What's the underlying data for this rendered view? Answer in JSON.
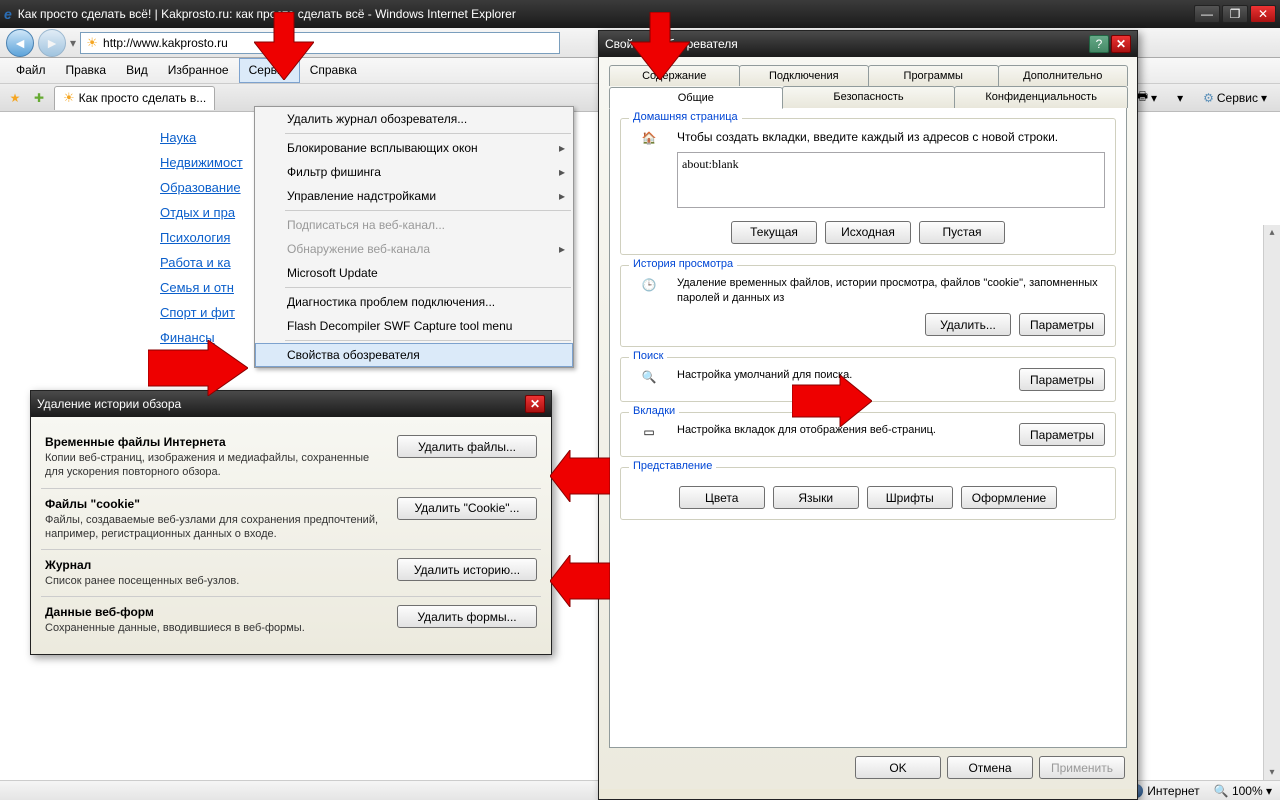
{
  "window": {
    "title": "Как просто сделать всё! | Kakprosto.ru: как просто сделать всё - Windows Internet Explorer"
  },
  "address": {
    "url": "http://www.kakprosto.ru"
  },
  "menubar": [
    "Файл",
    "Правка",
    "Вид",
    "Избранное",
    "Сервис",
    "Справка"
  ],
  "tab": {
    "label": "Как просто сделать в..."
  },
  "rightTools": {
    "service": "Сервис"
  },
  "sidebar": [
    "Наука",
    "Недвижимост",
    "Образование",
    "Отдых и пра",
    "Психология",
    "Работа и ка",
    "Семья и отн",
    "Спорт и фит",
    "Финансы"
  ],
  "dropdown": {
    "items": [
      {
        "label": "Удалить журнал обозревателя...",
        "type": "item"
      },
      {
        "type": "sep"
      },
      {
        "label": "Блокирование всплывающих окон",
        "type": "sub"
      },
      {
        "label": "Фильтр фишинга",
        "type": "sub"
      },
      {
        "label": "Управление надстройками",
        "type": "sub"
      },
      {
        "type": "sep"
      },
      {
        "label": "Подписаться на веб-канал...",
        "type": "item",
        "disabled": true
      },
      {
        "label": "Обнаружение веб-канала",
        "type": "sub",
        "disabled": true
      },
      {
        "label": "Microsoft Update",
        "type": "item"
      },
      {
        "type": "sep"
      },
      {
        "label": "Диагностика проблем подключения...",
        "type": "item"
      },
      {
        "label": "Flash Decompiler SWF Capture tool menu",
        "type": "item"
      },
      {
        "type": "sep"
      },
      {
        "label": "Свойства обозревателя",
        "type": "item",
        "hover": true
      }
    ]
  },
  "delDlg": {
    "title": "Удаление истории обзора",
    "sections": [
      {
        "h": "Временные файлы Интернета",
        "d": "Копии веб-страниц, изображения и медиафайлы, сохраненные для ускорения повторного обзора.",
        "btn": "Удалить файлы..."
      },
      {
        "h": "Файлы \"cookie\"",
        "d": "Файлы, создаваемые веб-узлами для сохранения предпочтений, например, регистрационных данных о входе.",
        "btn": "Удалить \"Cookie\"..."
      },
      {
        "h": "Журнал",
        "d": "Список ранее посещенных веб-узлов.",
        "btn": "Удалить историю..."
      },
      {
        "h": "Данные веб-форм",
        "d": "Сохраненные данные, вводившиеся в веб-формы.",
        "btn": "Удалить формы..."
      }
    ]
  },
  "optDlg": {
    "title": "Свойства обозревателя",
    "tabsRow1": [
      "Содержание",
      "Подключения",
      "Программы",
      "Дополнительно"
    ],
    "tabsRow2": [
      "Общие",
      "Безопасность",
      "Конфиденциальность"
    ],
    "activeTab": "Общие",
    "homepage": {
      "legend": "Домашняя страница",
      "text": "Чтобы создать вкладки, введите каждый из адресов с новой строки.",
      "value": "about:blank",
      "btns": [
        "Текущая",
        "Исходная",
        "Пустая"
      ]
    },
    "history": {
      "legend": "История просмотра",
      "text": "Удаление временных файлов, истории просмотра, файлов \"cookie\", запомненных паролей и данных из",
      "btns": [
        "Удалить...",
        "Параметры"
      ]
    },
    "search": {
      "legend": "Поиск",
      "text": "Настройка умолчаний для поиска.",
      "btn": "Параметры"
    },
    "tabsGroup": {
      "legend": "Вкладки",
      "text": "Настройка вкладок для отображения веб-страниц.",
      "btn": "Параметры"
    },
    "appearance": {
      "legend": "Представление",
      "btns": [
        "Цвета",
        "Языки",
        "Шрифты",
        "Оформление"
      ]
    },
    "footer": [
      "OK",
      "Отмена",
      "Применить"
    ]
  },
  "status": {
    "zone": "Интернет",
    "zoom": "100%"
  }
}
